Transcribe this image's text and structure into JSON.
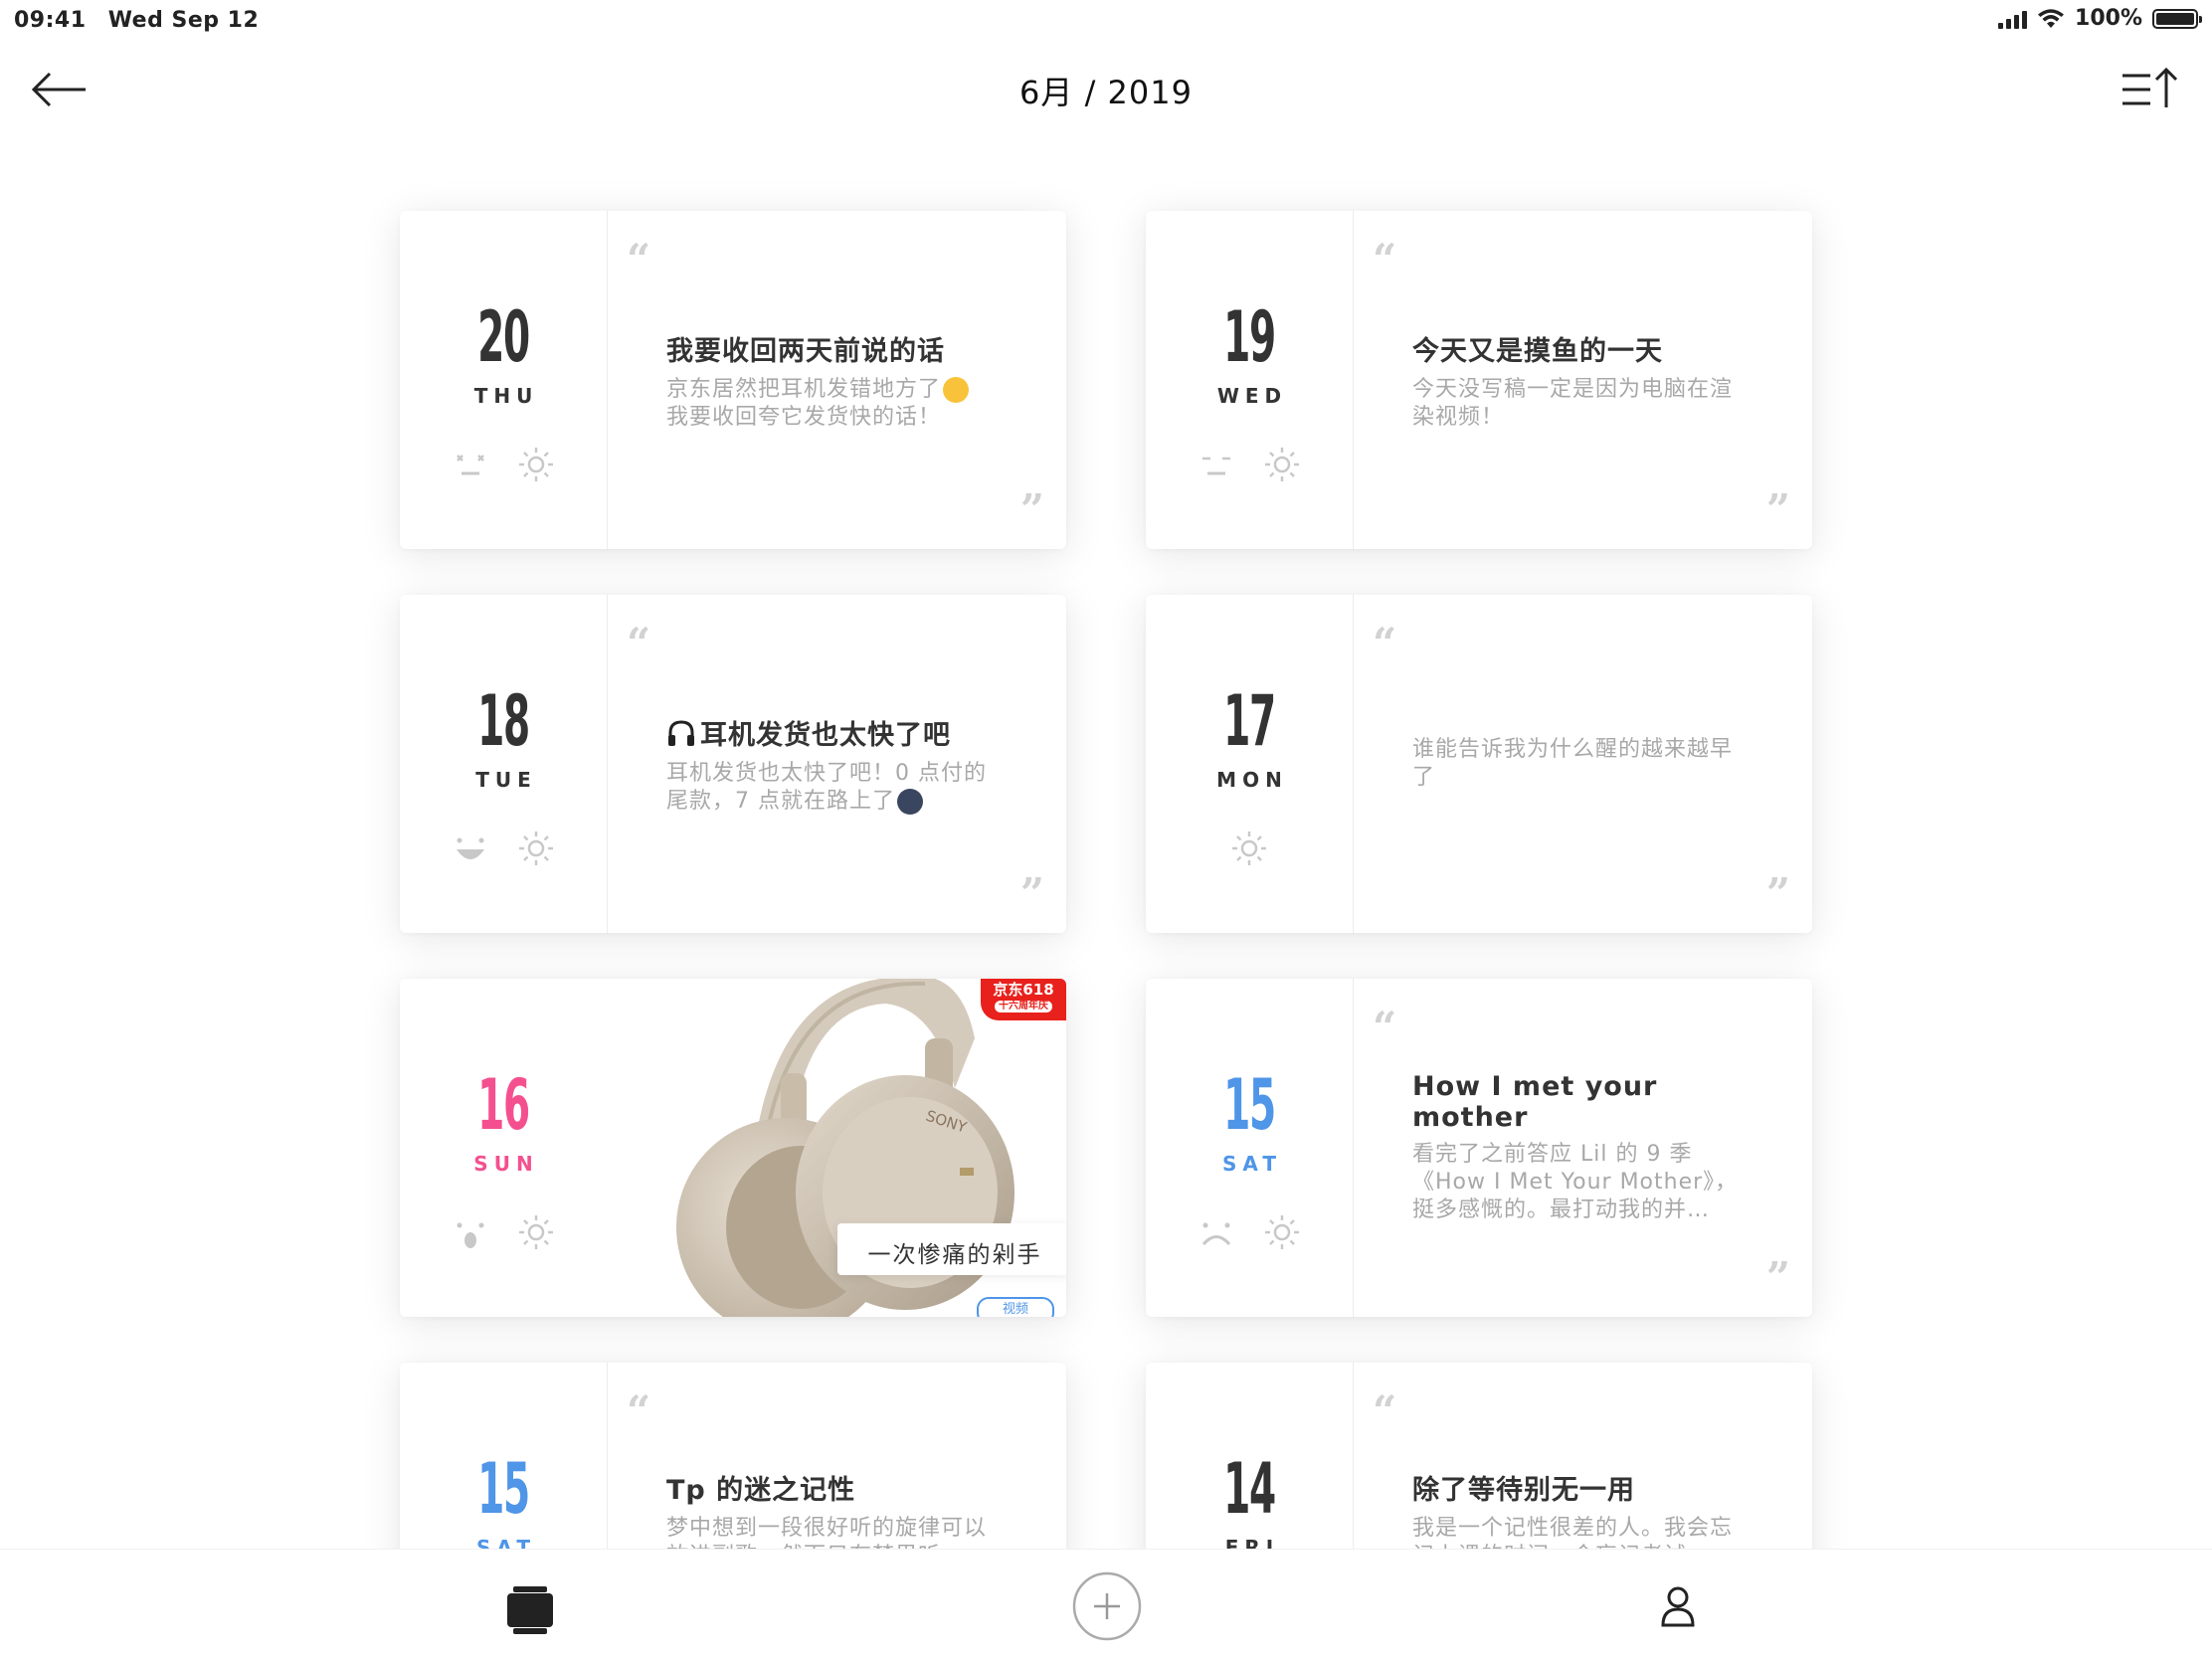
{
  "status_bar": {
    "time": "09:41",
    "date": "Wed Sep 12",
    "battery": "100%",
    "icons": [
      "signal-icon",
      "wifi-icon",
      "battery-icon"
    ]
  },
  "nav": {
    "title": "6月 / 2019",
    "back_icon": "back-arrow-icon",
    "sort_icon": "sort-icon"
  },
  "entries": [
    {
      "day": "20",
      "weekday": "THU",
      "mood": "blank-face",
      "weather": "sunny",
      "title": "我要收回两天前说的话",
      "body": "京东居然把耳机发错地方了",
      "body2": "我要收回夸它发货快的话！"
    },
    {
      "day": "19",
      "weekday": "WED",
      "mood": "sleepy-face",
      "weather": "sunny",
      "title": "今天又是摸鱼的一天",
      "body": "今天没写稿一定是因为电脑在渲染视频！"
    },
    {
      "day": "18",
      "weekday": "TUE",
      "mood": "happy-face",
      "weather": "sunny",
      "title": "耳机发货也太快了吧",
      "body": "耳机发货也太快了吧！0 点付的尾款，7 点就在路上了"
    },
    {
      "day": "17",
      "weekday": "MON",
      "weather": "sunny",
      "body": "谁能告诉我为什么醒的越来越早了"
    },
    {
      "day": "16",
      "weekday": "SUN",
      "mood": "surprised-face",
      "weather": "sunny",
      "photo_caption": "一次惨痛的剁手",
      "photo_badge": "京东618",
      "photo_badge_sub": "十六周年庆",
      "photo_brand": "SONY",
      "photo_tag": "视频"
    },
    {
      "day": "15",
      "weekday": "SAT",
      "mood": "sad-face",
      "weather": "sunny",
      "title": "How I met your mother",
      "body": "看完了之前答应 Lil 的 9 季《How I Met Your Mother》，挺多感慨的。最打动我的并…"
    },
    {
      "day": "15",
      "weekday": "SAT",
      "title": "Tp 的迷之记性",
      "body": "梦中想到一段很好听的旋律可以放进副歌，然而只有梦里听"
    },
    {
      "day": "14",
      "weekday": "FRI",
      "title": "除了等待别无一用",
      "body": "我是一个记性很差的人。我会忘记上课的时间，会忘记考试"
    }
  ],
  "accent_colors": {
    "sunday": "#f4508f",
    "saturday": "#4f95e8",
    "default": "#333333"
  },
  "tab_bar": [
    {
      "name": "timeline",
      "icon": "cards-icon"
    },
    {
      "name": "add",
      "icon": "plus-circle-icon"
    },
    {
      "name": "profile",
      "icon": "person-icon"
    }
  ]
}
